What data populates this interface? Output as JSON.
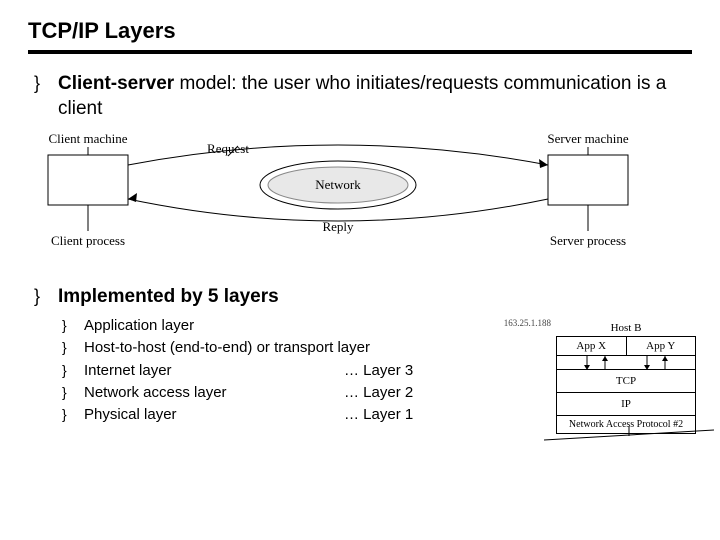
{
  "title": "TCP/IP Layers",
  "bullet_glyph": "}",
  "b1": {
    "lead": "Client-server",
    "rest": " model: the user who initiates/requests communication is a client"
  },
  "diagram": {
    "client_machine": "Client machine",
    "server_machine": "Server machine",
    "request": "Request",
    "reply": "Reply",
    "network": "Network",
    "client_process": "Client process",
    "server_process": "Server process"
  },
  "b2": {
    "text": "Implemented by 5 layers"
  },
  "layers": [
    {
      "name": "Application layer",
      "num": ""
    },
    {
      "name": "Host-to-host (end-to-end) or transport layer",
      "num": ""
    },
    {
      "name": "Internet layer",
      "num": "… Layer 3"
    },
    {
      "name": "Network access layer",
      "num": "… Layer 2"
    },
    {
      "name": "Physical layer",
      "num": "… Layer 1"
    }
  ],
  "stack": {
    "host": "Host B",
    "ip": "163.25.1.188",
    "app_x": "App X",
    "app_y": "App Y",
    "tcp": "TCP",
    "ip_layer": "IP",
    "nap": "Network Access Protocol #2"
  }
}
